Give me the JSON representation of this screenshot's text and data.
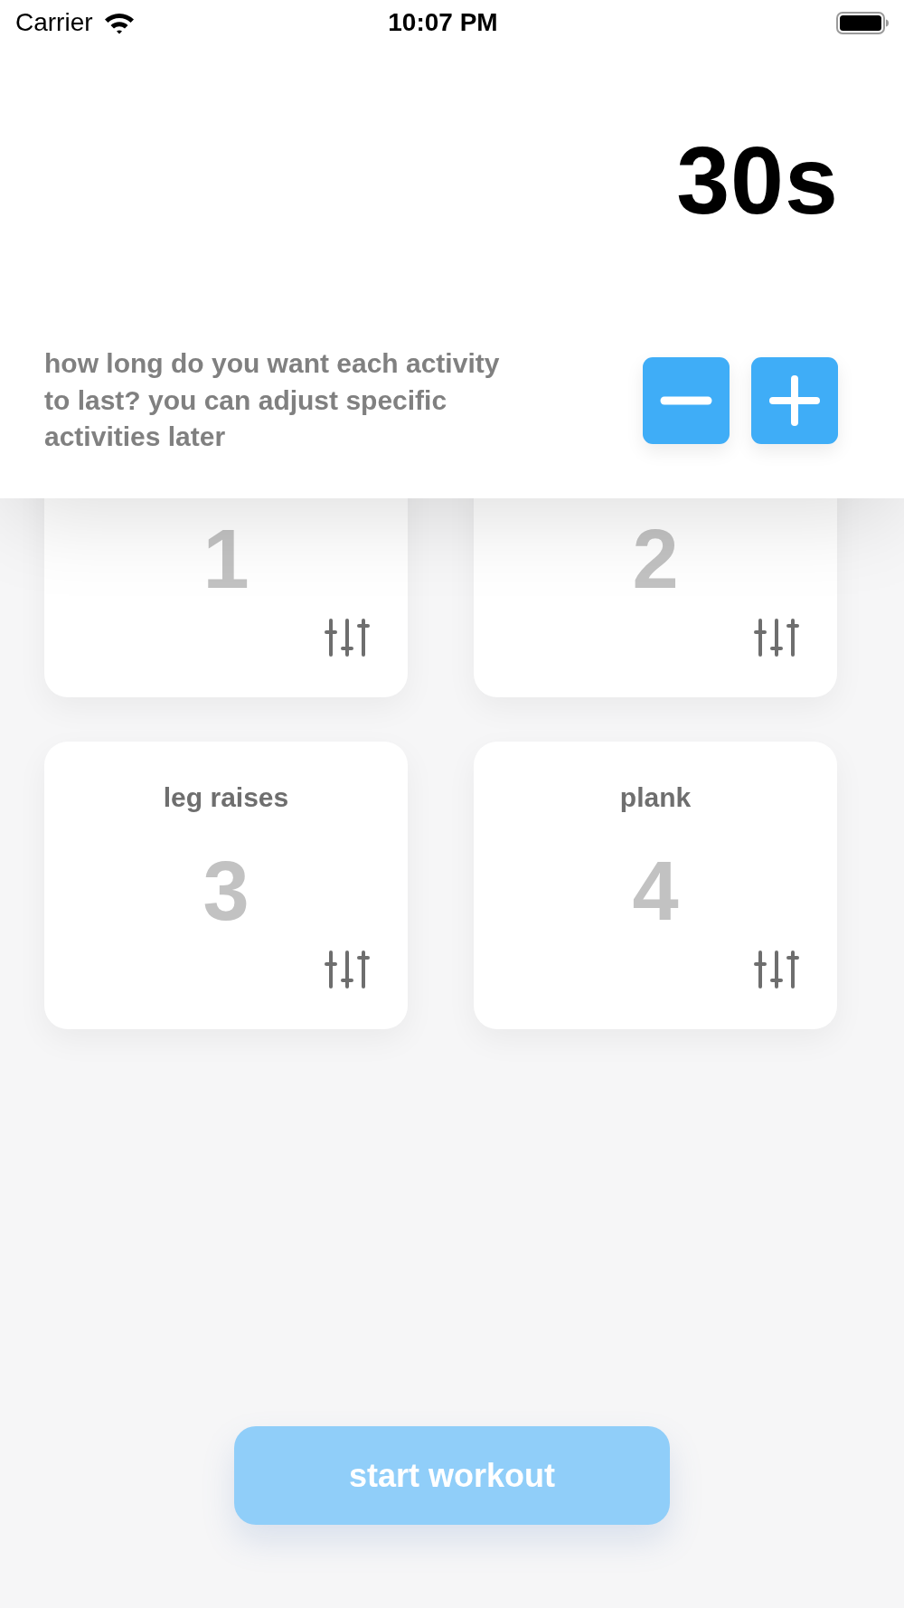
{
  "status_bar": {
    "carrier": "Carrier",
    "time": "10:07 PM"
  },
  "duration": {
    "value": "30s",
    "prompt": "how long do you want each activity to last? you can adjust specific activities later"
  },
  "activities": [
    {
      "number": "1"
    },
    {
      "number": "2"
    },
    {
      "name": "leg raises",
      "number": "3"
    },
    {
      "name": "plank",
      "number": "4"
    }
  ],
  "start_button": {
    "label": "start workout",
    "disabled": true
  }
}
